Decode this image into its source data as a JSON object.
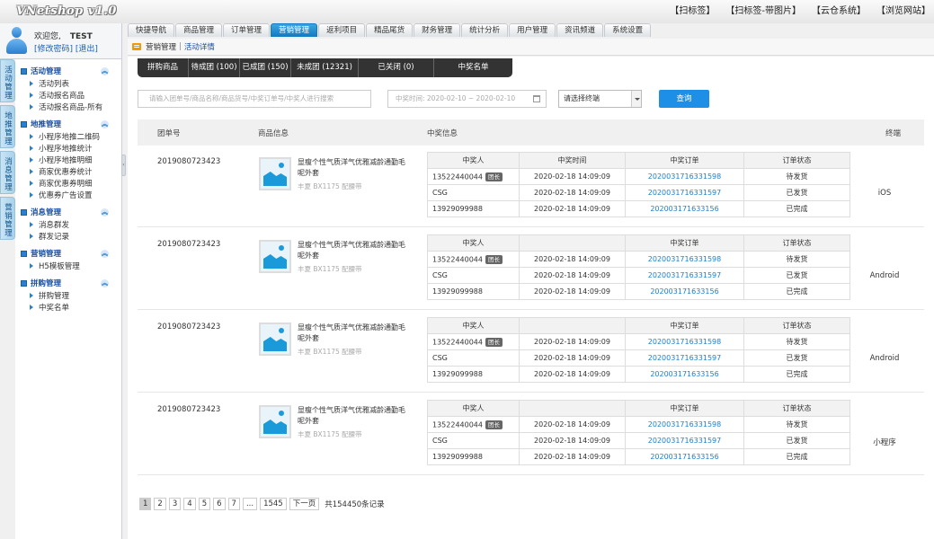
{
  "app": {
    "title": "VNetshop v1.0"
  },
  "top_links": [
    "【扫标签】",
    "【扫标签-带图片】",
    "【云仓系统】",
    "【浏览网站】"
  ],
  "user": {
    "welcome": "欢迎您,",
    "name": "TEST",
    "change_password": "[修改密码]",
    "logout": "[退出]"
  },
  "nav_tabs": [
    "快捷导航",
    "商品管理",
    "订单管理",
    "营销管理",
    "返利项目",
    "精品尾货",
    "财务管理",
    "统计分析",
    "用户管理",
    "资讯频道",
    "系统设置"
  ],
  "nav_active": "营销管理",
  "breadcrumb": {
    "parent": "营销管理",
    "sep": "|",
    "current": "活动详情"
  },
  "side_tabs": [
    "活动管理",
    "地推管理",
    "消息管理",
    "营销管理"
  ],
  "menu": [
    {
      "title": "活动管理",
      "items": [
        "活动列表",
        "活动报名商品",
        "活动报名商品-所有"
      ]
    },
    {
      "title": "地推管理",
      "items": [
        "小程序地推二维码",
        "小程序地推统计",
        "小程序地推明细",
        "商家优惠券统计",
        "商家优惠券明细",
        "优惠券广告设置"
      ]
    },
    {
      "title": "消息管理",
      "items": [
        "消息群发",
        "群发记录"
      ]
    },
    {
      "title": "营销管理",
      "items": [
        "H5模板管理"
      ]
    },
    {
      "title": "拼购管理",
      "items": [
        "拼购管理",
        "中奖名单"
      ]
    }
  ],
  "sub_tabs": [
    "拼购商品",
    "待成团 (100)",
    "已成团 (150)",
    "未成团 (12321)",
    "已关闭 (0)",
    "中奖名单"
  ],
  "filters": {
    "search_placeholder": "请输入团单号/商品名称/商品货号/中奖订单号/中奖人进行搜索",
    "date_range": "中奖时间: 2020-02-10 ~ 2020-02-10",
    "terminal_select": "请选择终端",
    "query_button": "查询"
  },
  "table_headers": {
    "group_no": "团单号",
    "product": "商品信息",
    "winning": "中奖信息",
    "terminal": "终端"
  },
  "win_headers": [
    "中奖人",
    "中奖时间",
    "中奖订单",
    "订单状态"
  ],
  "rows": [
    {
      "group_no": "2019080723423",
      "product_name": "显瘦个性气质洋气优雅减龄通勤毛呢外套",
      "product_sub": "丰夏 BX1175 配腰带",
      "terminal": "iOS",
      "show_time_header": true,
      "winners": [
        {
          "name": "13522440044",
          "badge": "团长",
          "time": "2020-02-18 14:09:09",
          "order": "2020031716331598",
          "status": "待发货"
        },
        {
          "name": "CSG",
          "badge": "",
          "time": "2020-02-18 14:09:09",
          "order": "2020031716331597",
          "status": "已发货"
        },
        {
          "name": "13929099988",
          "badge": "",
          "time": "2020-02-18 14:09:09",
          "order": "202003171633156",
          "status": "已完成"
        }
      ]
    },
    {
      "group_no": "2019080723423",
      "product_name": "显瘦个性气质洋气优雅减龄通勤毛呢外套",
      "product_sub": "丰夏 BX1175 配腰带",
      "terminal": "Android",
      "show_time_header": false,
      "winners": [
        {
          "name": "13522440044",
          "badge": "团长",
          "time": "2020-02-18 14:09:09",
          "order": "2020031716331598",
          "status": "待发货"
        },
        {
          "name": "CSG",
          "badge": "",
          "time": "2020-02-18 14:09:09",
          "order": "2020031716331597",
          "status": "已发货"
        },
        {
          "name": "13929099988",
          "badge": "",
          "time": "2020-02-18 14:09:09",
          "order": "202003171633156",
          "status": "已完成"
        }
      ]
    },
    {
      "group_no": "2019080723423",
      "product_name": "显瘦个性气质洋气优雅减龄通勤毛呢外套",
      "product_sub": "丰夏 BX1175 配腰带",
      "terminal": "Android",
      "show_time_header": false,
      "winners": [
        {
          "name": "13522440044",
          "badge": "团长",
          "time": "2020-02-18 14:09:09",
          "order": "2020031716331598",
          "status": "待发货"
        },
        {
          "name": "CSG",
          "badge": "",
          "time": "2020-02-18 14:09:09",
          "order": "2020031716331597",
          "status": "已发货"
        },
        {
          "name": "13929099988",
          "badge": "",
          "time": "2020-02-18 14:09:09",
          "order": "202003171633156",
          "status": "已完成"
        }
      ]
    },
    {
      "group_no": "2019080723423",
      "product_name": "显瘦个性气质洋气优雅减龄通勤毛呢外套",
      "product_sub": "丰夏 BX1175 配腰带",
      "terminal": "小程序",
      "show_time_header": false,
      "winners": [
        {
          "name": "13522440044",
          "badge": "团长",
          "time": "2020-02-18 14:09:09",
          "order": "2020031716331598",
          "status": "待发货"
        },
        {
          "name": "CSG",
          "badge": "",
          "time": "2020-02-18 14:09:09",
          "order": "2020031716331597",
          "status": "已发货"
        },
        {
          "name": "13929099988",
          "badge": "",
          "time": "2020-02-18 14:09:09",
          "order": "202003171633156",
          "status": "已完成"
        }
      ]
    }
  ],
  "pagination": {
    "pages": [
      "1",
      "2",
      "3",
      "4",
      "5",
      "6",
      "7",
      "...",
      "1545"
    ],
    "active": "1",
    "next": "下一页",
    "total": "共154450条记录"
  },
  "colors": {
    "accent": "#1e8fe6",
    "tab_active": "#1578c0",
    "link": "#1a7fd0",
    "menu_title": "#1a4fa0"
  },
  "icons": {
    "avatar": "user-avatar-icon",
    "breadcrumb": "folder-icon",
    "calendar": "calendar-icon",
    "product": "image-placeholder-icon"
  }
}
